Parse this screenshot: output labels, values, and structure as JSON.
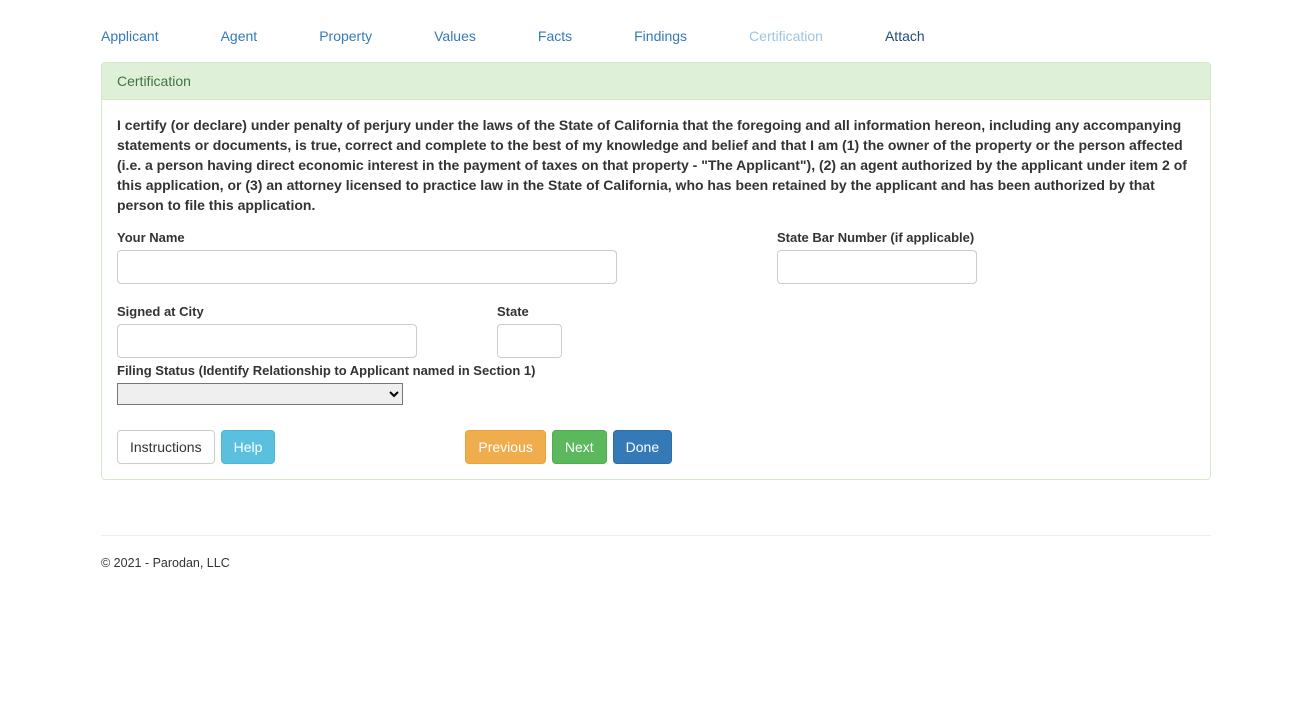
{
  "nav": {
    "tabs": [
      {
        "label": "Applicant",
        "key": "applicant"
      },
      {
        "label": "Agent",
        "key": "agent"
      },
      {
        "label": "Property",
        "key": "property"
      },
      {
        "label": "Values",
        "key": "values"
      },
      {
        "label": "Facts",
        "key": "facts"
      },
      {
        "label": "Findings",
        "key": "findings"
      },
      {
        "label": "Certification",
        "key": "certification",
        "active": true
      },
      {
        "label": "Attach",
        "key": "attach",
        "dark": true
      }
    ]
  },
  "panel": {
    "heading": "Certification",
    "cert_text": "I certify (or declare) under penalty of perjury under the laws of the State of California that the foregoing and all information hereon, including any accompanying statements or documents, is true, correct and complete to the best of my knowledge and belief and that I am (1) the owner of the property or the person affected (i.e. a person having direct economic interest in the payment of taxes on that property - \"The Applicant\"), (2) an agent authorized by the applicant under item 2 of this application, or (3) an attorney licensed to practice law in the State of California, who has been retained by the applicant and has been authorized by that person to file this application."
  },
  "fields": {
    "your_name": {
      "label": "Your Name",
      "value": ""
    },
    "state_bar": {
      "label": "State Bar Number (if applicable)",
      "value": ""
    },
    "signed_city": {
      "label": "Signed at City",
      "value": ""
    },
    "state": {
      "label": "State",
      "value": ""
    },
    "filing_status": {
      "label": "Filing Status (Identify Relationship to Applicant named in Section 1)",
      "value": ""
    }
  },
  "buttons": {
    "instructions": "Instructions",
    "help": "Help",
    "previous": "Previous",
    "next": "Next",
    "done": "Done"
  },
  "footer": "© 2021 - Parodan, LLC"
}
